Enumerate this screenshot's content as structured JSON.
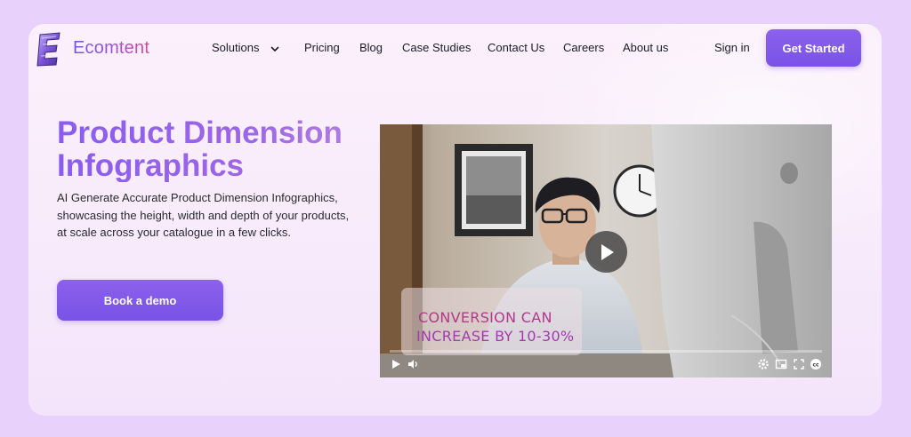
{
  "brand": {
    "name": "Ecomtent"
  },
  "nav": {
    "items": [
      {
        "label": "Solutions"
      },
      {
        "label": "Pricing"
      },
      {
        "label": "Blog"
      },
      {
        "label": "Case Studies"
      },
      {
        "label": "Contact Us"
      },
      {
        "label": "Careers"
      },
      {
        "label": "About us"
      }
    ],
    "sign_in": "Sign in",
    "get_started": "Get Started"
  },
  "hero": {
    "title_line1": "Product Dimension",
    "title_line2": "Infographics",
    "description": "AI Generate Accurate Product Dimension Infographics, showcasing the height, width and depth of your products, at scale across your catalogue in a few clicks.",
    "demo_button": "Book a demo"
  },
  "video": {
    "overlay_line1": "CONVERSION CAN",
    "overlay_line2": "INCREASE BY  10-30%",
    "icons": [
      "play-icon",
      "volume-icon",
      "settings-icon",
      "picture-in-picture-icon",
      "fullscreen-icon",
      "captions-icon"
    ]
  },
  "colors": {
    "page_bg": "#e8d2fb",
    "accent": "#7c55e8",
    "title_gradient_start": "#8a5cf0",
    "overlay_text": "#b03a8a"
  }
}
